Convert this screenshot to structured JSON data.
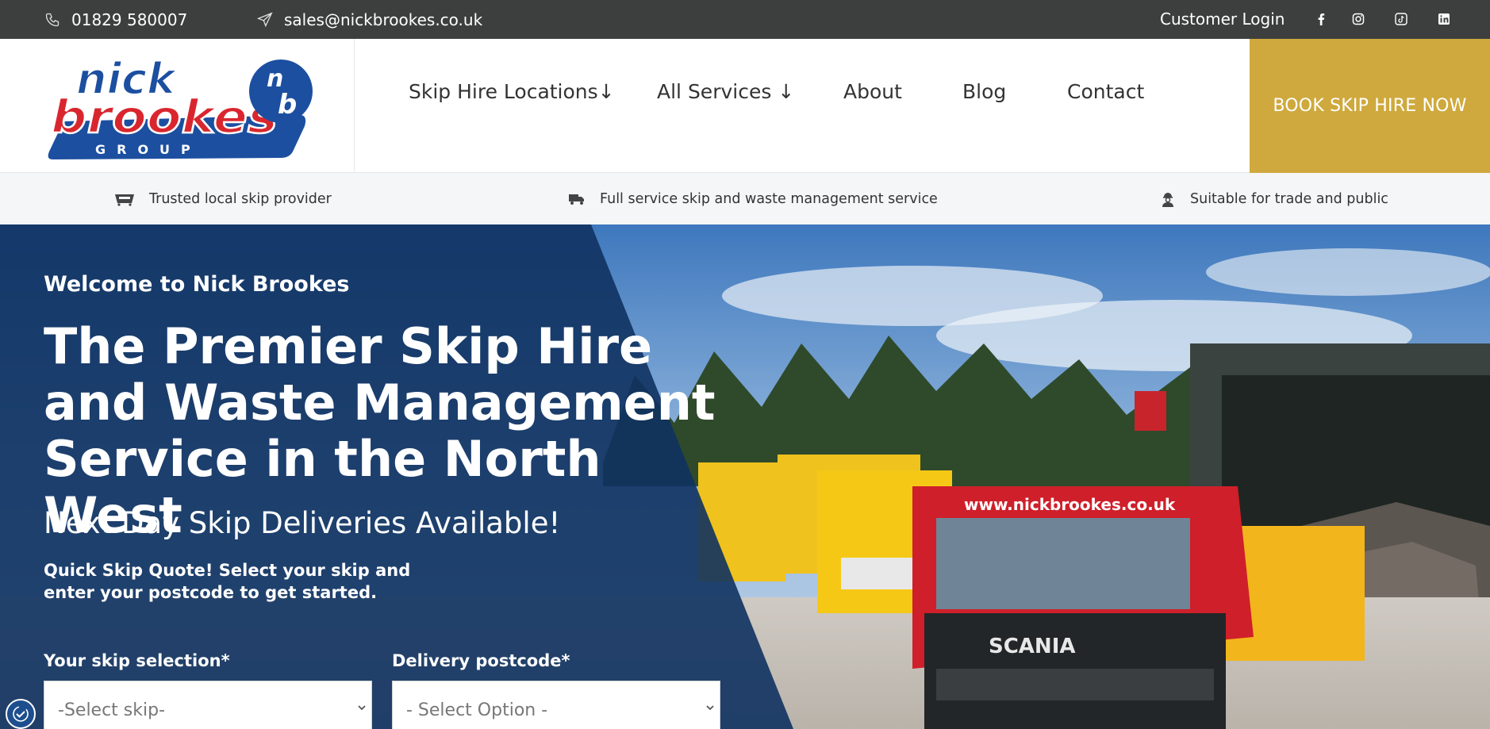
{
  "topbar": {
    "phone": "01829 580007",
    "email": "sales@nickbrookes.co.uk",
    "login": "Customer Login",
    "social_icons": [
      "facebook-icon",
      "instagram-icon",
      "tiktok-icon",
      "linkedin-icon"
    ]
  },
  "logo": {
    "line1": "nick",
    "line2": "brookes",
    "line3": "GROUP",
    "monogram_top": "n",
    "monogram_bottom": "b"
  },
  "nav": {
    "items": [
      {
        "label": "Skip Hire Locations↓"
      },
      {
        "label": "All Services  ↓"
      },
      {
        "label": "About"
      },
      {
        "label": "Blog"
      },
      {
        "label": "Contact"
      }
    ],
    "cta": "BOOK SKIP HIRE NOW"
  },
  "features": [
    {
      "icon": "skip-icon",
      "text": "Trusted local skip provider"
    },
    {
      "icon": "truck-icon",
      "text": "Full service skip and waste management service"
    },
    {
      "icon": "worker-icon",
      "text": "Suitable for trade and public"
    }
  ],
  "hero": {
    "welcome": "Welcome to Nick Brookes",
    "headline": "The Premier Skip Hire and Waste Management Service in the North West",
    "subhead": "Next Day Skip Deliveries Available!",
    "quote_text": "Quick Skip Quote! Select your skip and enter your postcode to get started.",
    "truck_text": "www.nickbrookes.co.uk",
    "truck_brand": "SCANIA"
  },
  "form": {
    "skip_label": "Your skip selection*",
    "skip_value": "-Select skip-",
    "postcode_label": "Delivery postcode*",
    "postcode_value": "- Select Option -"
  },
  "colors": {
    "topbar": "#3d3f3f",
    "gold": "#cfa93d",
    "navy": "#0f3260",
    "brand_red": "#d9262e",
    "brand_blue": "#1c4fa0"
  }
}
